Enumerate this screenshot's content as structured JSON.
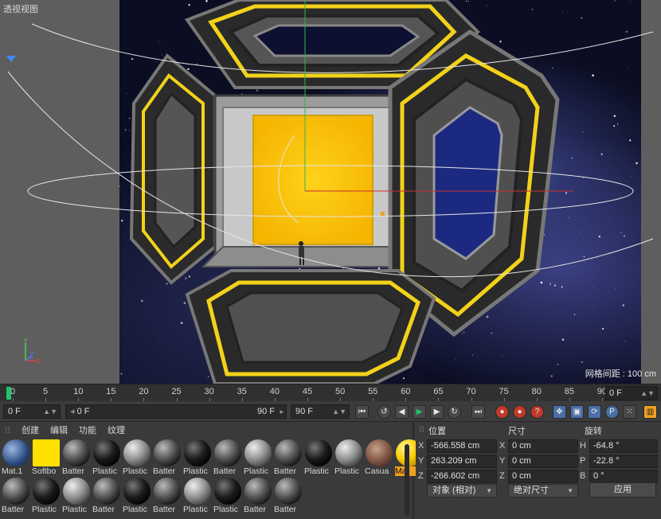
{
  "viewport": {
    "title": "透视视图",
    "grid_spacing": "网格间距 : 100 cm",
    "axis_labels": {
      "y": "Y",
      "z": "Z",
      "x": "X"
    }
  },
  "timeline": {
    "ticks": [
      "0",
      "5",
      "10",
      "15",
      "20",
      "25",
      "30",
      "35",
      "40",
      "45",
      "50",
      "55",
      "60",
      "65",
      "70",
      "75",
      "80",
      "85",
      "90"
    ],
    "current_frame": "0 F",
    "playhead_frame": 0
  },
  "transport": {
    "start": "0 F",
    "range_start": "0 F",
    "range_end": "90 F",
    "end": "90 F",
    "buttons": [
      "first-frame",
      "prev-key",
      "prev-frame",
      "play",
      "next-frame",
      "next-key",
      "last-frame",
      "record",
      "autokey",
      "keyframe-selection",
      "move",
      "scale",
      "rotate",
      "parameter",
      "point-level-animation"
    ]
  },
  "materials": {
    "menu": [
      "创建",
      "编辑",
      "功能",
      "纹理"
    ],
    "row1": [
      {
        "label": "Mat.1",
        "kind": "earth"
      },
      {
        "label": "Softbo",
        "kind": "yellow-flat"
      },
      {
        "label": "Batter",
        "kind": "dark-metal"
      },
      {
        "label": "Plastic",
        "kind": "black"
      },
      {
        "label": "Plastic",
        "kind": "grey"
      },
      {
        "label": "Batter",
        "kind": "dark-metal"
      },
      {
        "label": "Plastic",
        "kind": "black"
      },
      {
        "label": "Batter",
        "kind": "dark-metal"
      },
      {
        "label": "Plastic",
        "kind": "grey"
      },
      {
        "label": "Batter",
        "kind": "dark-metal"
      },
      {
        "label": "Plastic",
        "kind": "black"
      },
      {
        "label": "Plastic",
        "kind": "grey"
      },
      {
        "label": "Casua",
        "kind": "fabric"
      },
      {
        "label": "Mat",
        "kind": "yellow",
        "selected": true
      }
    ],
    "row2": [
      {
        "label": "Batter",
        "kind": "dark-metal"
      },
      {
        "label": "Plastic",
        "kind": "black"
      },
      {
        "label": "Plastic",
        "kind": "grey"
      },
      {
        "label": "Batter",
        "kind": "dark-metal"
      },
      {
        "label": "Plastic",
        "kind": "black"
      },
      {
        "label": "Batter",
        "kind": "dark-metal"
      },
      {
        "label": "Plastic",
        "kind": "grey"
      },
      {
        "label": "Plastic",
        "kind": "black"
      },
      {
        "label": "Batter",
        "kind": "dark-metal"
      },
      {
        "label": "Batter",
        "kind": "dark-metal"
      }
    ]
  },
  "coords": {
    "position_header": "位置",
    "size_header": "尺寸",
    "rotation_header": "旋转",
    "position": {
      "x": "-566.558 cm",
      "y": "263.209 cm",
      "z": "-266.602 cm"
    },
    "size": {
      "x": "0 cm",
      "y": "0 cm",
      "z": "0 cm"
    },
    "rotation": {
      "h": "-64.8 °",
      "p": "-22.8 °",
      "b": "0 °"
    },
    "mode_dropdown": "对象 (相对)",
    "size_dropdown": "绝对尺寸",
    "apply": "应用"
  },
  "colors": {
    "accent_yellow": "#ffc400",
    "playhead": "#22c26b",
    "selection": "#f0a020"
  }
}
